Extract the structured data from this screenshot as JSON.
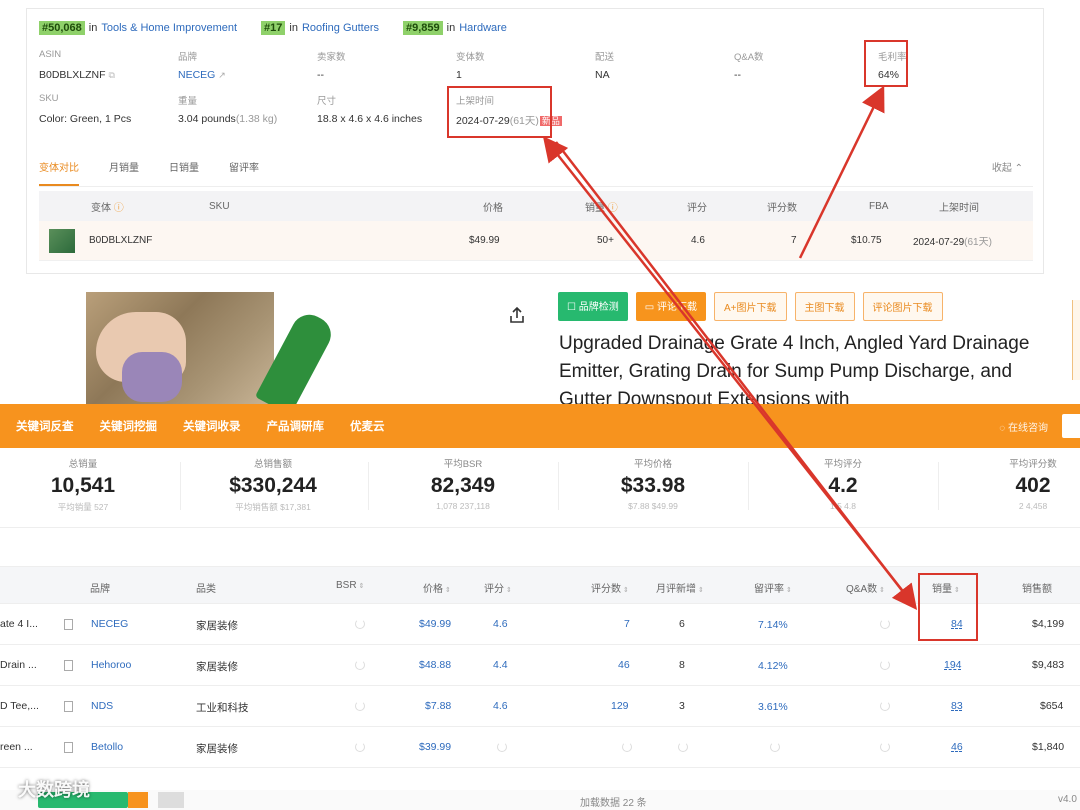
{
  "ranks": [
    {
      "rank": "#50,068",
      "in": "in",
      "category": "Tools & Home Improvement"
    },
    {
      "rank": "#17",
      "in": "in",
      "category": "Roofing Gutters"
    },
    {
      "rank": "#9,859",
      "in": "in",
      "category": "Hardware"
    }
  ],
  "info": {
    "asin_label": "ASIN",
    "asin": "B0DBLXLZNF",
    "brand_label": "品牌",
    "brand": "NECEG",
    "sellers_label": "卖家数",
    "sellers": "--",
    "variants_label": "变体数",
    "variants": "1",
    "ship_label": "配送",
    "ship": "NA",
    "qa_label": "Q&A数",
    "qa": "--",
    "margin_label": "毛利率",
    "margin": "64%",
    "sku_label": "SKU",
    "sku": "Color: Green, 1 Pcs",
    "weight_label": "重量",
    "weight": "3.04 pounds",
    "weight_kg": "(1.38 kg)",
    "size_label": "尺寸",
    "size": "18.8 x 4.6 x 4.6 inches",
    "listed_label": "上架时间",
    "listed": "2024-07-29",
    "listed_days": "(61天)",
    "new_tag": "新品"
  },
  "tabs": [
    "变体对比",
    "月销量",
    "日销量",
    "留评率"
  ],
  "collapse": "收起",
  "variant_table": {
    "headers": [
      "变体",
      "SKU",
      "价格",
      "销量",
      "评分",
      "评分数",
      "FBA",
      "上架时间"
    ],
    "row": {
      "asin": "B0DBLXLZNF",
      "price": "$49.99",
      "sales": "50+",
      "rating": "4.6",
      "reviews": "7",
      "fba": "$10.75",
      "date": "2024-07-29",
      "days": "(61天)"
    }
  },
  "buttons": [
    "品牌检测",
    "评论下载",
    "A+图片下载",
    "主图下载",
    "评论图片下载"
  ],
  "product_title": "Upgraded Drainage Grate 4 Inch, Angled Yard Drainage Emitter, Grating Drain for Sump Pump Discharge, and Gutter Downspout Extensions with",
  "nav": [
    "关键词反查",
    "关键词挖掘",
    "关键词收录",
    "产品调研库",
    "优麦云"
  ],
  "consult": "在线咨询",
  "stats": [
    {
      "label": "总销量",
      "value": "10,541",
      "sub": "平均销量 527"
    },
    {
      "label": "总销售额",
      "value": "$330,244",
      "sub": "平均销售额 $17,381"
    },
    {
      "label": "平均BSR",
      "value": "82,349",
      "sub": "1,078 237,118"
    },
    {
      "label": "平均价格",
      "value": "$33.98",
      "sub": "$7.88 $49.99"
    },
    {
      "label": "平均评分",
      "value": "4.2",
      "sub": "1.5 4.8"
    },
    {
      "label": "平均评分数",
      "value": "402",
      "sub": "2 4,458"
    }
  ],
  "table": {
    "headers": [
      "品牌",
      "品类",
      "BSR",
      "价格",
      "评分",
      "评分数",
      "月评新增",
      "留评率",
      "Q&A数",
      "销量",
      "销售额"
    ],
    "rows": [
      {
        "name": "ate 4 I...",
        "brand": "NECEG",
        "cat": "家居装修",
        "price": "$49.99",
        "rating": "4.6",
        "reviews": "7",
        "new": "6",
        "rate": "7.14%",
        "sales": "84",
        "revenue": "$4,199"
      },
      {
        "name": "Drain ...",
        "brand": "Hehoroo",
        "cat": "家居装修",
        "price": "$48.88",
        "rating": "4.4",
        "reviews": "46",
        "new": "8",
        "rate": "4.12%",
        "sales": "194",
        "revenue": "$9,483"
      },
      {
        "name": "D Tee,...",
        "brand": "NDS",
        "cat": "工业和科技",
        "price": "$7.88",
        "rating": "4.6",
        "reviews": "129",
        "new": "3",
        "rate": "3.61%",
        "sales": "83",
        "revenue": "$654"
      },
      {
        "name": "reen ...",
        "brand": "Betollo",
        "cat": "家居装修",
        "price": "$39.99",
        "rating": "",
        "reviews": "",
        "new": "",
        "rate": "",
        "sales": "46",
        "revenue": "$1,840"
      }
    ]
  },
  "footer": {
    "loaded": "加载数据 22 条",
    "version": "v4.0"
  },
  "watermark": "大数跨境",
  "colors": {
    "accent": "#f7931e",
    "annotation": "#d9362b",
    "link": "#2e6bbd"
  }
}
